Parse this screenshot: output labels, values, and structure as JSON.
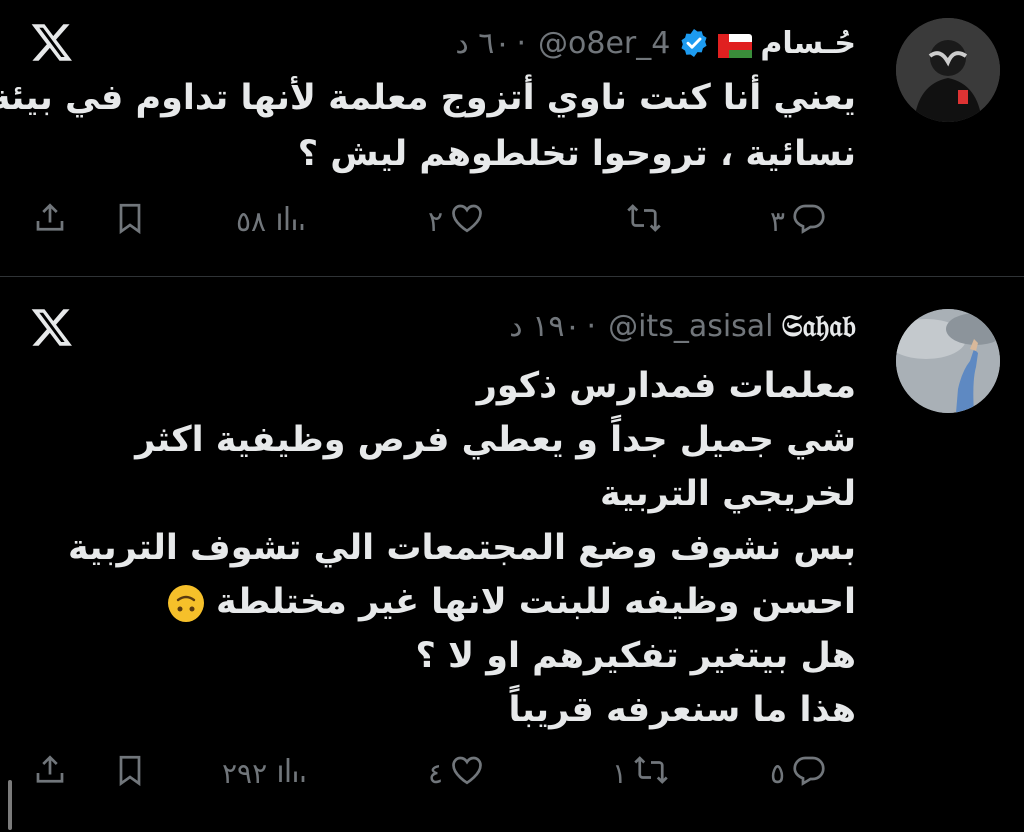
{
  "tweets": [
    {
      "author": "حُـسام",
      "handle": "@o8er_4",
      "time": "٦٠ د",
      "lines": [
        "يعني أنا كنت ناوي أتزوج معلمة لأنها تداوم في بيئة",
        "نسائية ، تروحوا تخلطوهم ليش ؟"
      ],
      "stats": {
        "replies": "٣",
        "retweets": "",
        "likes": "٢",
        "views": "٥٨"
      }
    },
    {
      "author": "𝔖𝔞𝔥𝔞𝔟",
      "handle": "@its_asisal",
      "time": "١٩٠ د",
      "lines": [
        "معلمات فمدارس ذكور",
        "شي جميل جداً و يعطي فرص وظيفية اكثر",
        "لخريجي التربية",
        "بس نشوف وضع المجتمعات الي تشوف التربية",
        "احسن وظيفه للبنت لانها غير مختلطة",
        "هل بيتغير تفكيرهم او لا ؟",
        "هذا ما سنعرفه قريباً"
      ],
      "emoji": "upside-down-face",
      "stats": {
        "replies": "٥",
        "retweets": "١",
        "likes": "٤",
        "views": "٢٩٢"
      }
    }
  ],
  "colors": {
    "background": "#000000",
    "text": "#e7e9ea",
    "muted": "#71767b",
    "verified": "#1d9bf0"
  },
  "icons": [
    "x-logo-icon",
    "verified-icon",
    "oman-flag-icon",
    "reply-icon",
    "retweet-icon",
    "like-icon",
    "views-icon",
    "bookmark-icon",
    "share-icon"
  ]
}
